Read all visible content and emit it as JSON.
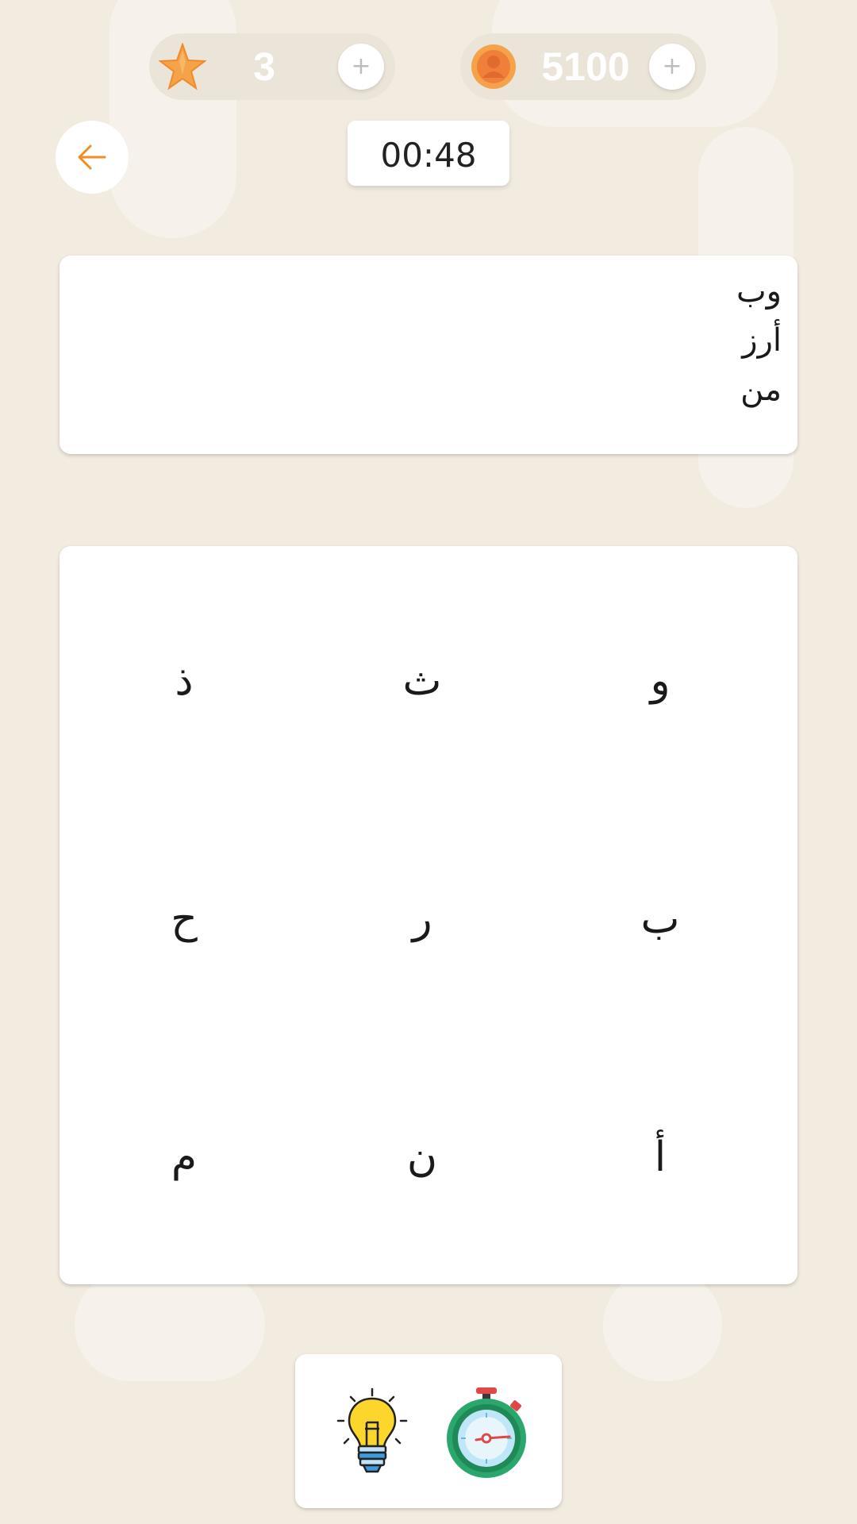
{
  "hud": {
    "stars": "3",
    "coins": "5100",
    "plus": "+",
    "star_icon": "star-icon",
    "coin_icon": "coin-icon"
  },
  "timer": "00:48",
  "target_words": [
    "وب",
    "أرز",
    "من"
  ],
  "letter_grid": [
    [
      "ذ",
      "ث",
      "و"
    ],
    [
      "ح",
      "ر",
      "ب"
    ],
    [
      "م",
      "ن",
      "أ"
    ]
  ],
  "powerups": [
    {
      "icon": "lightbulb-icon"
    },
    {
      "icon": "stopwatch-icon"
    }
  ],
  "colors": {
    "background": "#f2ebe0",
    "accent": "#f28c28",
    "pill": "#ebe4d9"
  }
}
